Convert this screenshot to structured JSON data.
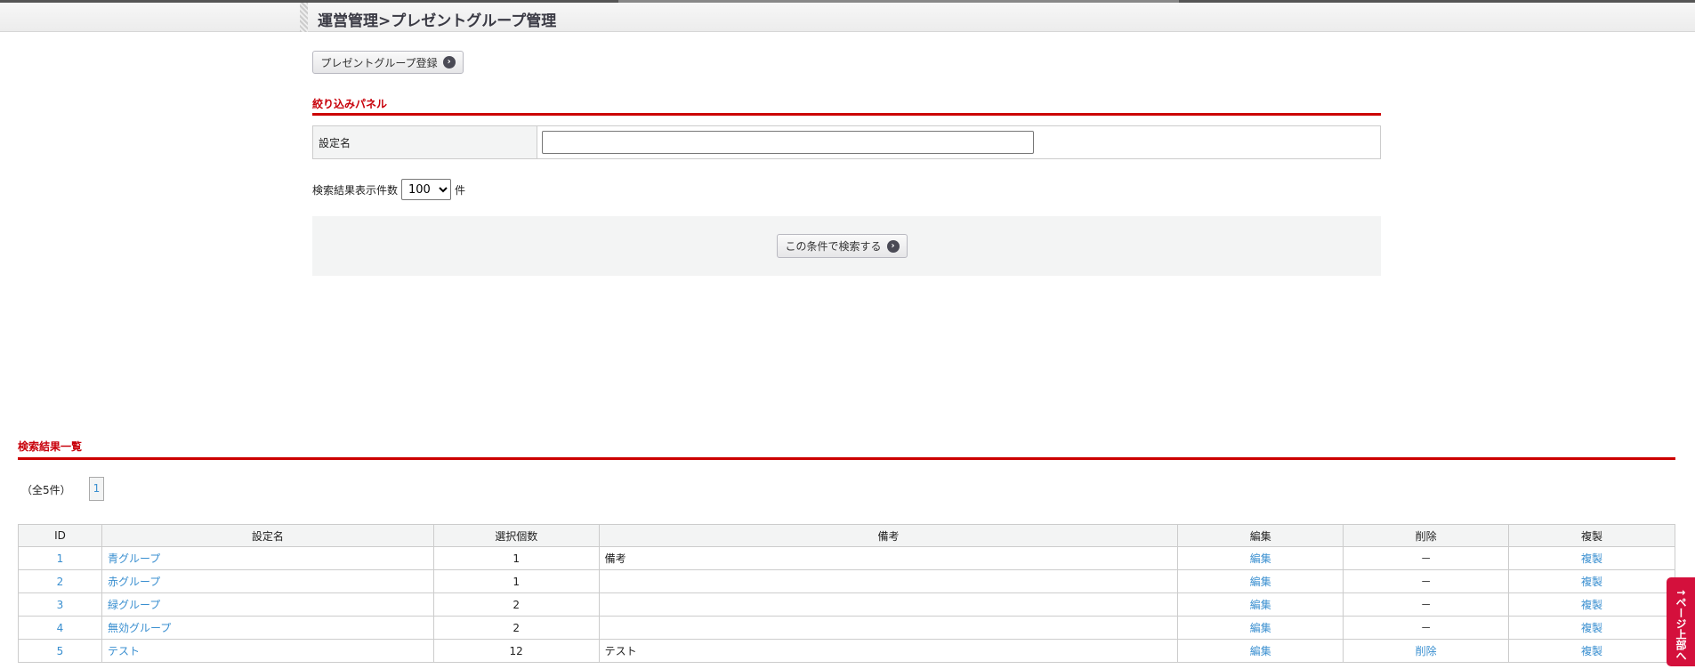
{
  "header": {
    "title": "運営管理>プレゼントグループ管理"
  },
  "register_button": "プレゼントグループ登録",
  "filter": {
    "title": "絞り込みパネル",
    "name_label": "設定名",
    "name_value": "",
    "count_label": "検索結果表示件数",
    "count_value": "100",
    "count_unit": "件",
    "search_button": "この条件で検索する"
  },
  "results": {
    "title": "検索結果一覧",
    "total": "（全5件）",
    "page": "1",
    "columns": [
      "ID",
      "設定名",
      "選択個数",
      "備考",
      "編集",
      "削除",
      "複製"
    ],
    "rows": [
      {
        "id": "1",
        "name": "青グループ",
        "count": "1",
        "note": "備考",
        "edit": "編集",
        "delete": "－",
        "copy": "複製"
      },
      {
        "id": "2",
        "name": "赤グループ",
        "count": "1",
        "note": "",
        "edit": "編集",
        "delete": "－",
        "copy": "複製"
      },
      {
        "id": "3",
        "name": "緑グループ",
        "count": "2",
        "note": "",
        "edit": "編集",
        "delete": "－",
        "copy": "複製"
      },
      {
        "id": "4",
        "name": "無効グループ",
        "count": "2",
        "note": "",
        "edit": "編集",
        "delete": "－",
        "copy": "複製"
      },
      {
        "id": "5",
        "name": "テスト",
        "count": "12",
        "note": "テスト",
        "edit": "編集",
        "delete": "削除",
        "copy": "複製"
      }
    ]
  },
  "page_top": "↑ページ上部へ",
  "colors": {
    "accent": "#cc0000",
    "link": "#3a8fd0",
    "page_top": "#d4103c"
  }
}
